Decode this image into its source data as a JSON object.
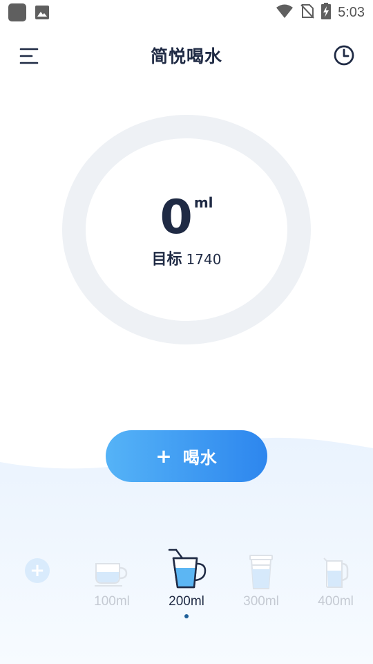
{
  "status_bar": {
    "time": "5:03",
    "icons": [
      "app-icon",
      "image-icon",
      "wifi-icon",
      "no-sim-icon",
      "battery-charging-icon"
    ]
  },
  "header": {
    "title": "简悦喝水",
    "menu_icon": "menu-icon",
    "history_icon": "history-clock-icon"
  },
  "progress": {
    "amount": "0",
    "unit": "ml",
    "goal_label": "目标",
    "goal_value": "1740",
    "fraction": 0
  },
  "drink_button": {
    "icon": "+",
    "label": "喝水"
  },
  "cups": {
    "add_icon": "+",
    "items": [
      {
        "label": "100ml",
        "icon": "teacup-icon",
        "selected": false
      },
      {
        "label": "200ml",
        "icon": "mug-with-straw-icon",
        "selected": true
      },
      {
        "label": "300ml",
        "icon": "takeaway-cup-icon",
        "selected": false
      },
      {
        "label": "400ml",
        "icon": "jug-icon",
        "selected": false
      }
    ]
  },
  "colors": {
    "primary_dark": "#1f2a44",
    "accent_start": "#55b3f7",
    "accent_end": "#2d86ee",
    "ring_track": "#eef1f5",
    "wave": "#eef5fe",
    "cup_inactive": "#c5cad3"
  }
}
